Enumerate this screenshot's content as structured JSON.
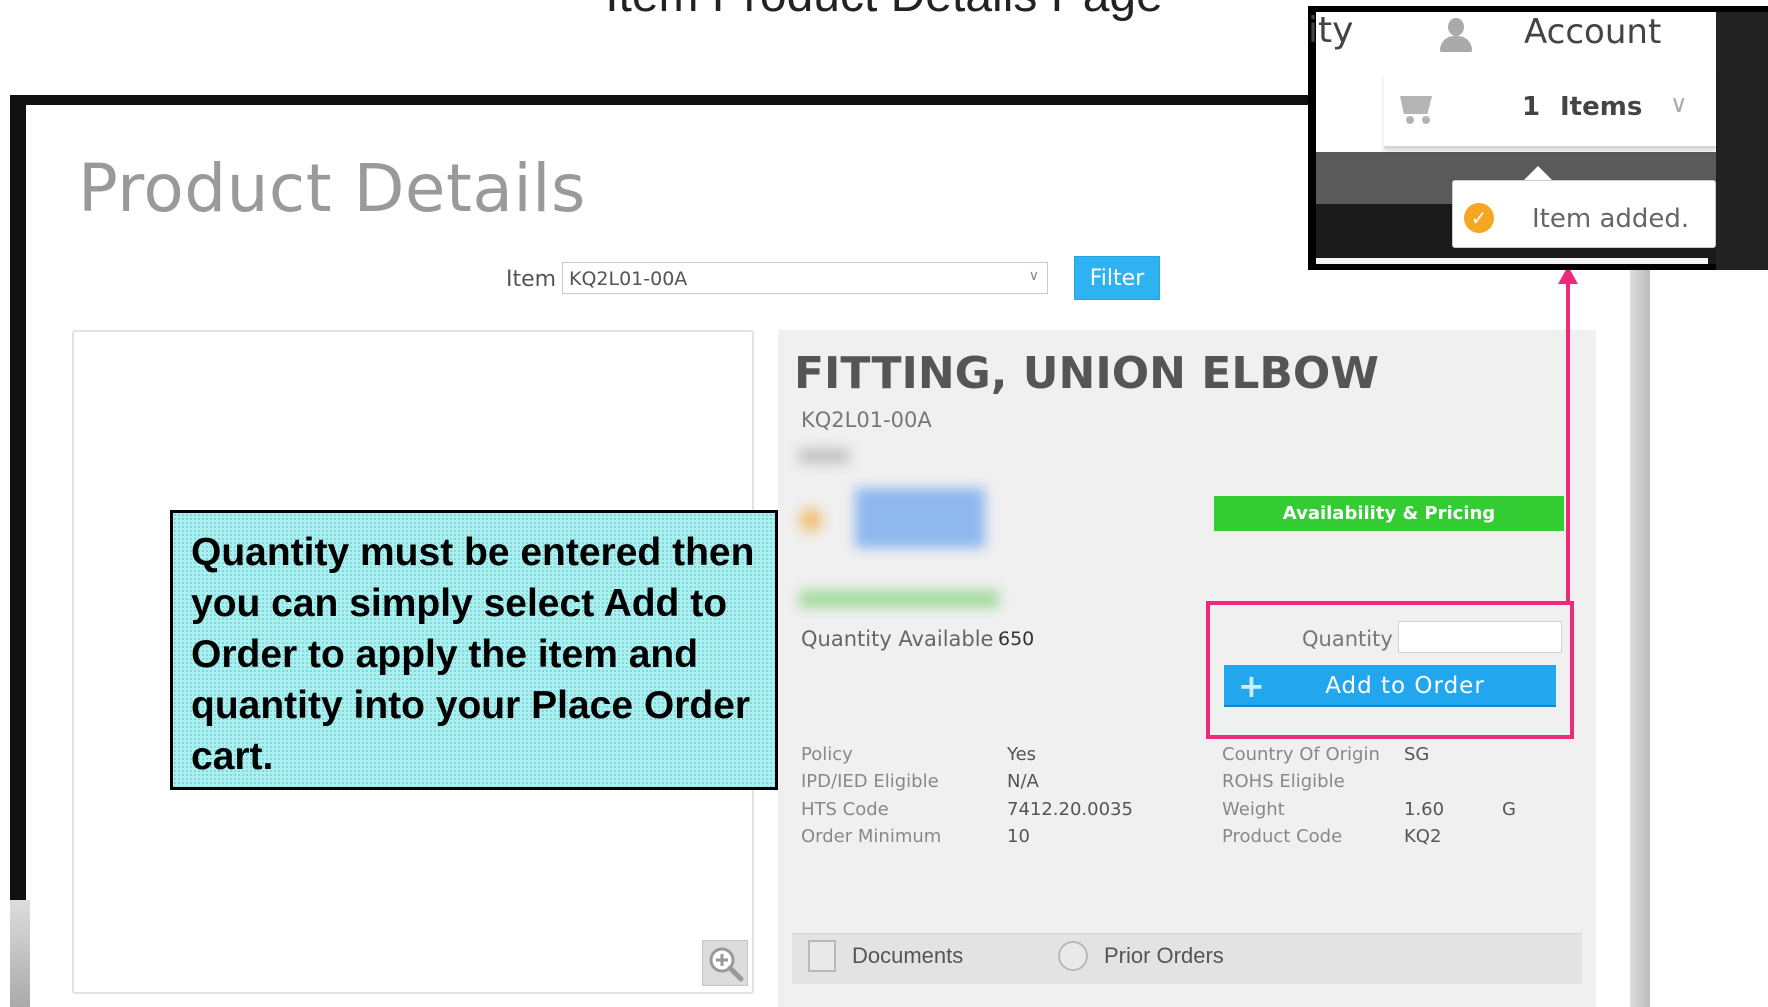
{
  "slide": {
    "title": "Item Product Details Page"
  },
  "page": {
    "heading": "Product Details"
  },
  "filter": {
    "item_label": "Item",
    "item_value": "KQ2L01-00A",
    "button_label": "Filter"
  },
  "product": {
    "name": "FITTING, UNION ELBOW",
    "sku": "KQ2L01-00A",
    "availability_button": "Availability & Pricing",
    "quantity_available_label": "Quantity Available",
    "quantity_available_value": "650",
    "quantity_label": "Quantity",
    "add_to_order_label": "Add to Order"
  },
  "specs_left": [
    {
      "label": "Policy",
      "value": "Yes"
    },
    {
      "label": "IPD/IED Eligible",
      "value": "N/A"
    },
    {
      "label": "HTS Code",
      "value": "7412.20.0035"
    },
    {
      "label": "Order Minimum",
      "value": "10"
    }
  ],
  "specs_right": [
    {
      "label": "Country Of Origin",
      "value": "SG",
      "unit": ""
    },
    {
      "label": "ROHS Eligible",
      "value": "",
      "unit": ""
    },
    {
      "label": "Weight",
      "value": "1.60",
      "unit": "G"
    },
    {
      "label": "Product Code",
      "value": "KQ2",
      "unit": ""
    }
  ],
  "tabs": {
    "documents": "Documents",
    "prior_orders": "Prior Orders"
  },
  "callout": {
    "text": "Quantity must be entered then you can simply select Add to Order to apply the item and quantity into your Place Order cart."
  },
  "header_inset": {
    "partial_text": "ity",
    "account_label": "Account",
    "cart_count": "1",
    "cart_items_label": "Items",
    "toast_text": "Item added."
  },
  "icons": {
    "user": "user-icon",
    "cart": "cart-icon",
    "check": "check-circle-icon",
    "zoom": "zoom-in-icon",
    "documents": "document-icon",
    "prior_orders": "history-icon"
  },
  "colors": {
    "filter_button": "#2fb2f2",
    "availability_button": "#33cc33",
    "add_button": "#22a7ef",
    "highlight": "#ef2a7d",
    "callout_bg": "#aaf0f0",
    "toast_check": "#f5a623"
  }
}
